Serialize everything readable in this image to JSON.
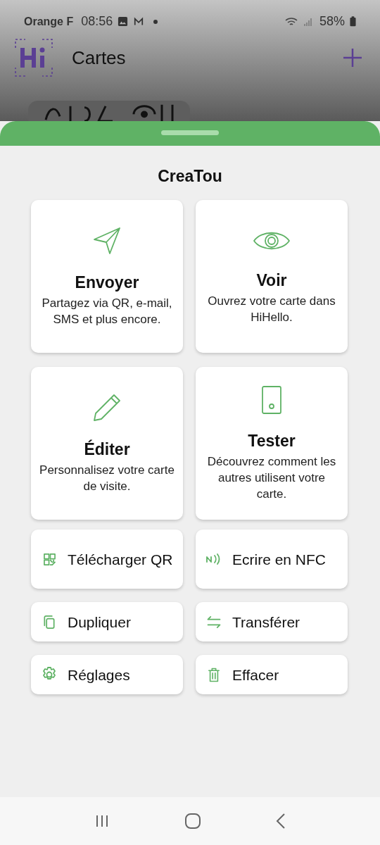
{
  "status_bar": {
    "carrier": "Orange F",
    "time": "08:56",
    "battery": "58%"
  },
  "header": {
    "title": "Cartes"
  },
  "sheet": {
    "title": "CreaTou",
    "cards": [
      {
        "title": "Envoyer",
        "text": "Partagez via QR, e-mail, SMS et plus encore."
      },
      {
        "title": "Voir",
        "text": "Ouvrez votre carte dans HiHello."
      },
      {
        "title": "Éditer",
        "text": "Personnalisez votre carte de visite."
      },
      {
        "title": "Tester",
        "text": "Découvrez comment les autres utilisent votre carte."
      }
    ],
    "actions": [
      {
        "label": "Télécharger QR"
      },
      {
        "label": "Ecrire en NFC"
      },
      {
        "label": "Dupliquer"
      },
      {
        "label": "Transférer"
      },
      {
        "label": "Réglages"
      },
      {
        "label": "Effacer"
      }
    ]
  }
}
